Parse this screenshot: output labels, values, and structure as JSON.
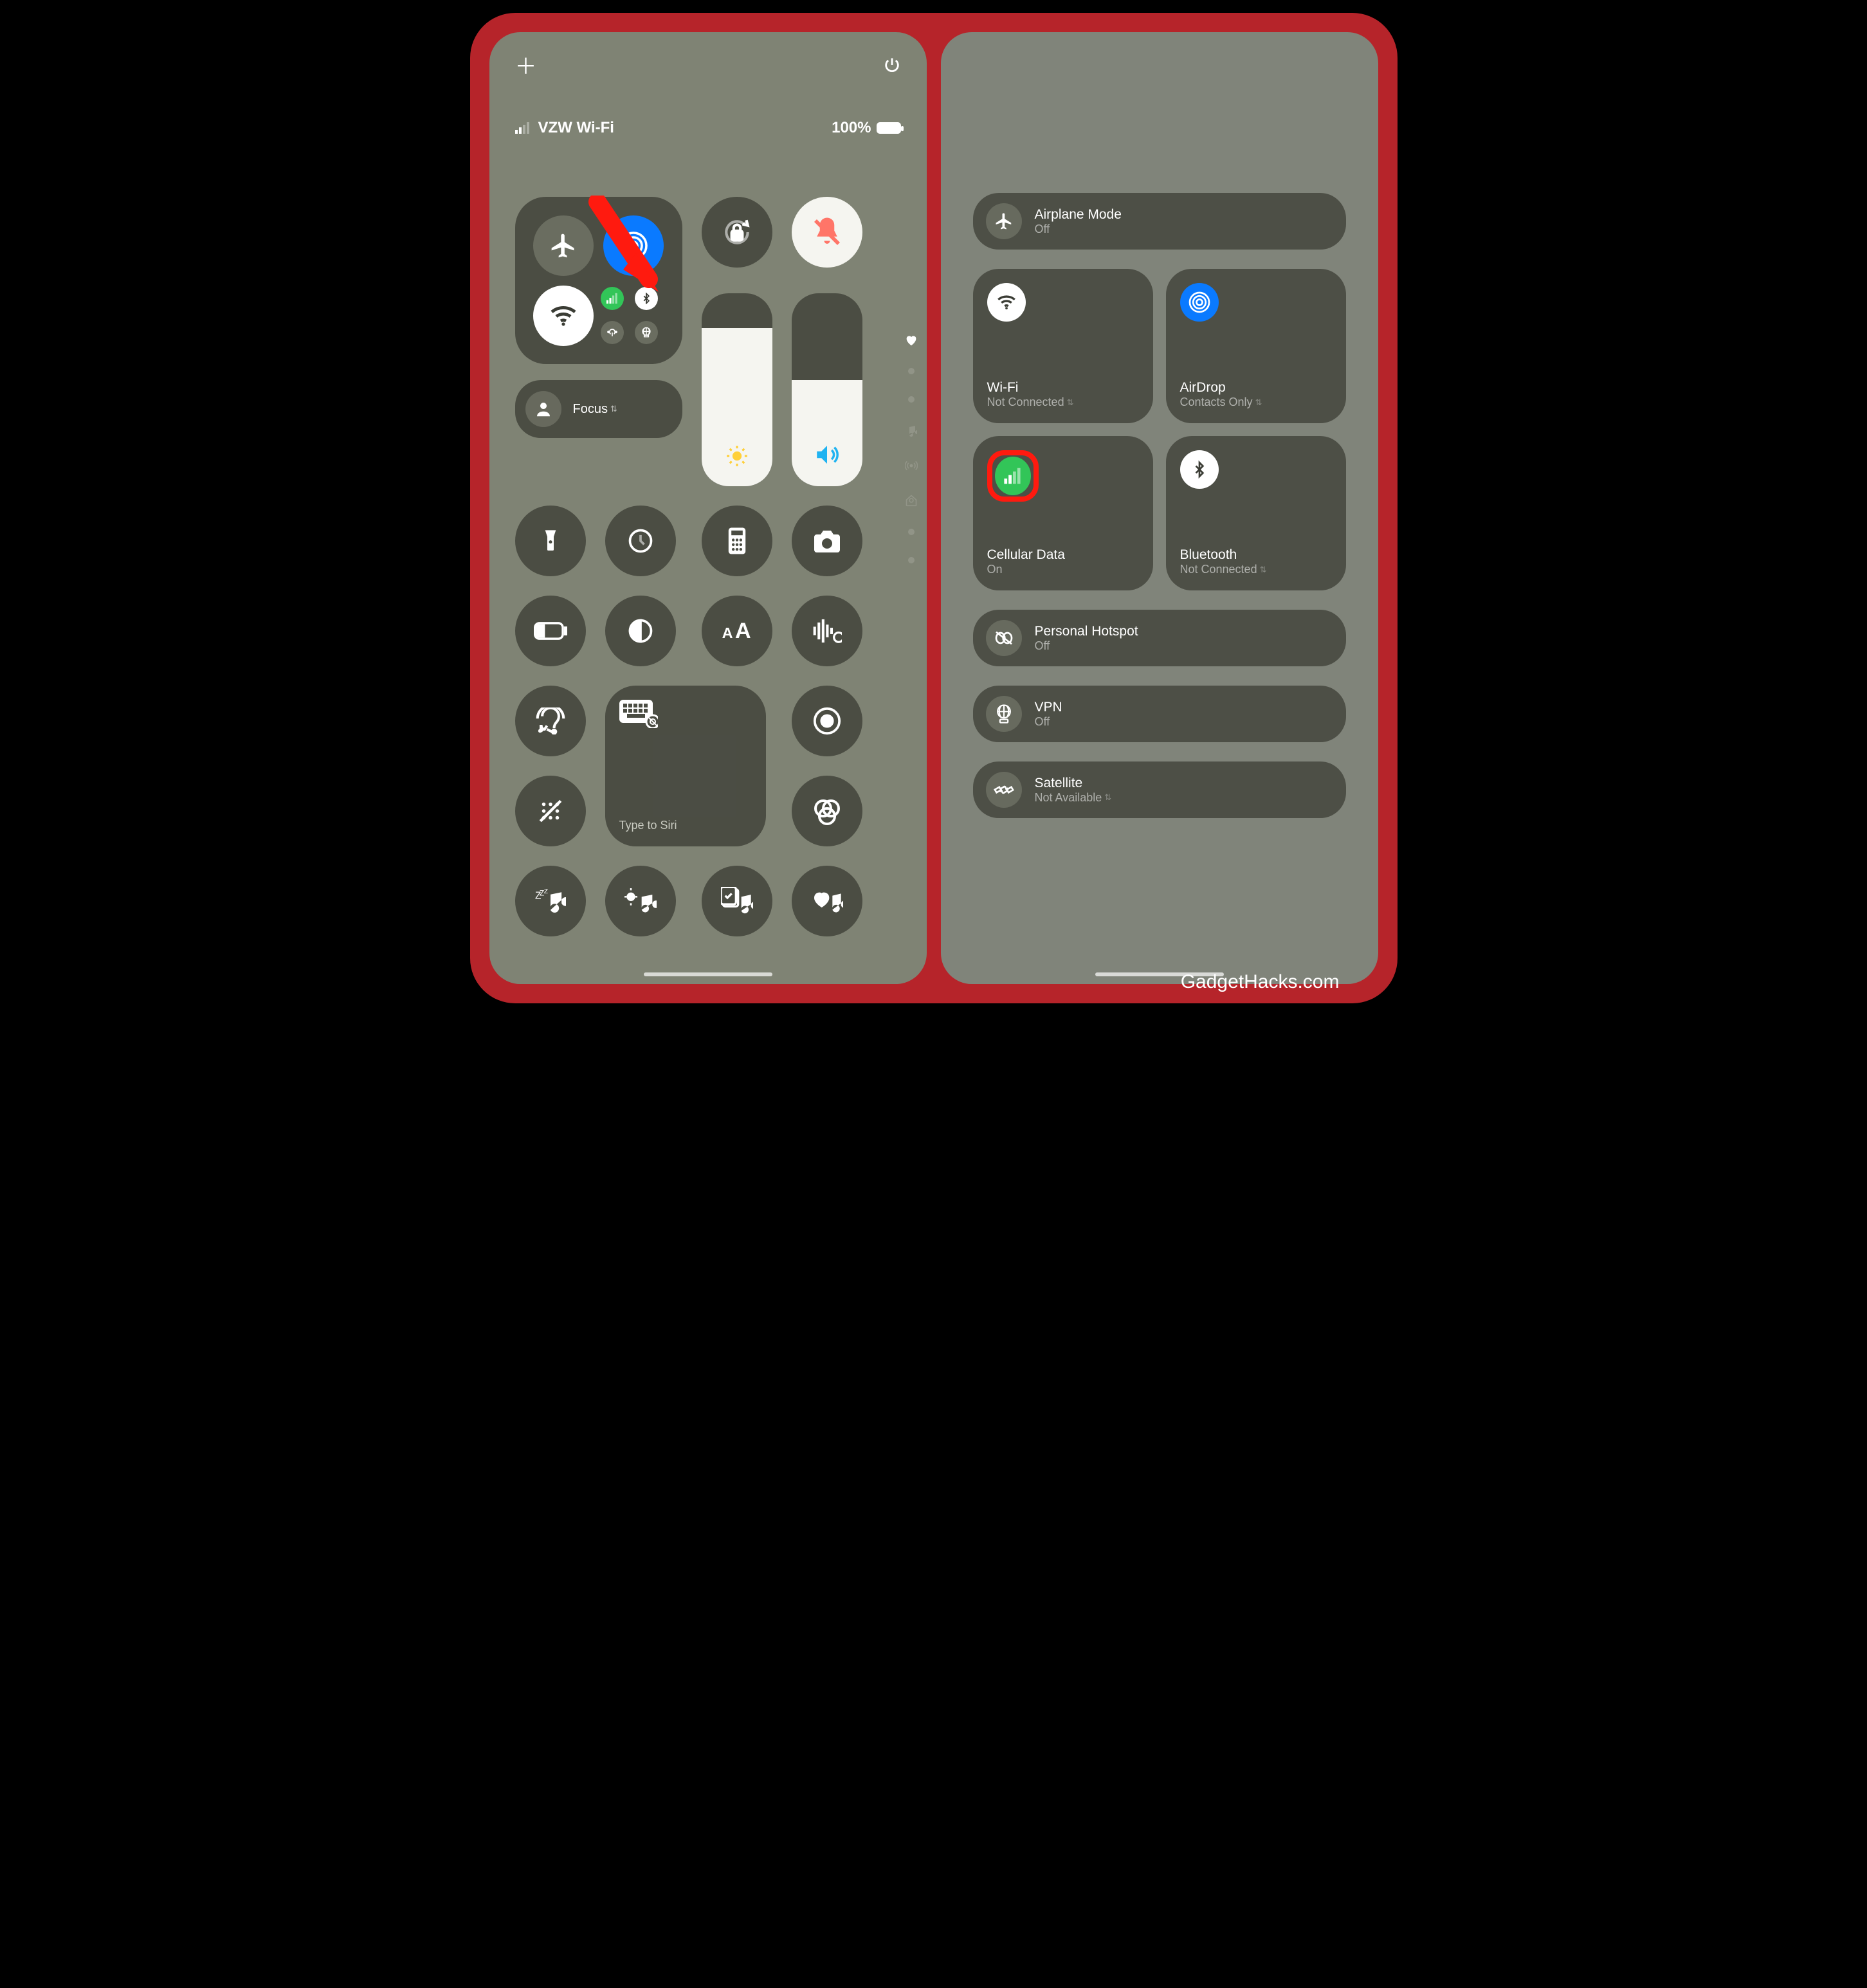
{
  "watermark": "GadgetHacks.com",
  "screen1": {
    "carrier": "VZW Wi-Fi",
    "battery": "100%",
    "focus": "Focus",
    "siri": "Type to Siri",
    "sliders": {
      "brightness_pct": 82,
      "volume_pct": 55
    }
  },
  "screen2": {
    "airplane": {
      "title": "Airplane Mode",
      "sub": "Off"
    },
    "wifi": {
      "title": "Wi-Fi",
      "sub": "Not Connected"
    },
    "airdrop": {
      "title": "AirDrop",
      "sub": "Contacts Only"
    },
    "cellular": {
      "title": "Cellular Data",
      "sub": "On"
    },
    "bluetooth": {
      "title": "Bluetooth",
      "sub": "Not Connected"
    },
    "hotspot": {
      "title": "Personal Hotspot",
      "sub": "Off"
    },
    "vpn": {
      "title": "VPN",
      "sub": "Off"
    },
    "satellite": {
      "title": "Satellite",
      "sub": "Not Available"
    }
  },
  "colors": {
    "accent_red": "#b6242a",
    "bg_olive": "#7f8374",
    "card": "rgba(60,62,54,0.78)",
    "blue": "#0a7aff",
    "green": "#32c558",
    "highlight": "#ff1a0f"
  }
}
